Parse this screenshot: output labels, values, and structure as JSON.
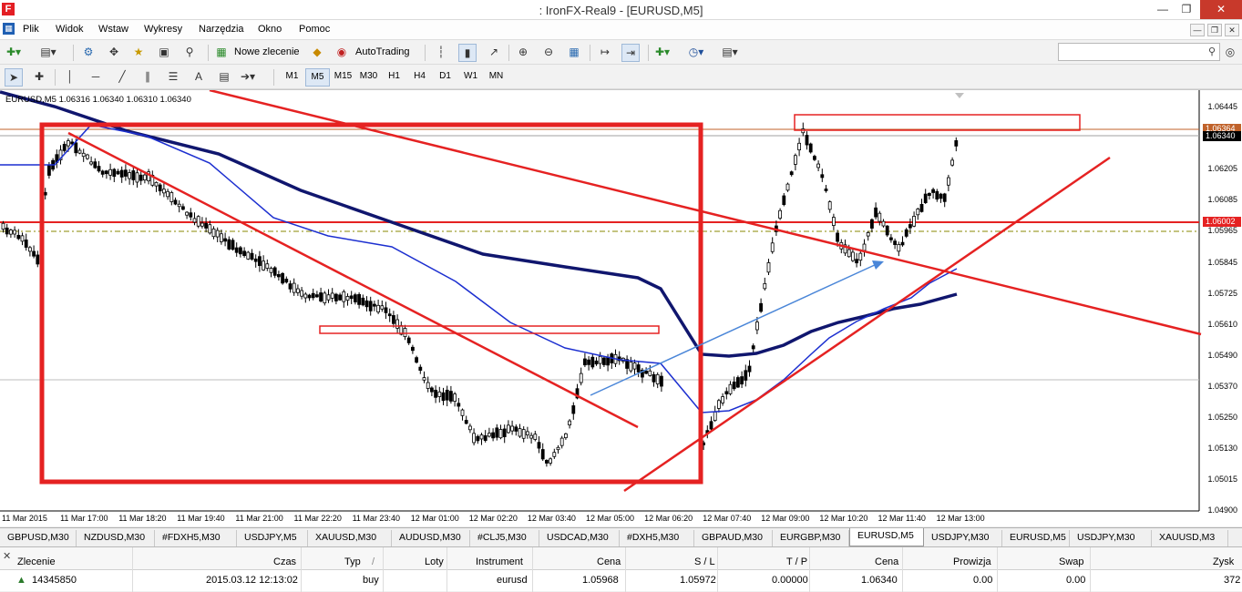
{
  "app": {
    "title": ": IronFX-Real9 - [EURUSD,M5]",
    "logo": "F"
  },
  "menu": [
    "Plik",
    "Widok",
    "Wstaw",
    "Wykresy",
    "Narzędzia",
    "Okno",
    "Pomoc"
  ],
  "toolbar": {
    "new_order_label": "Nowe zlecenie",
    "autotrading_label": "AutoTrading",
    "search_placeholder": ""
  },
  "timeframes": [
    "M1",
    "M5",
    "M15",
    "M30",
    "H1",
    "H4",
    "D1",
    "W1",
    "MN"
  ],
  "active_timeframe": "M5",
  "chart": {
    "header": "EURUSD,M5  1.06316 1.06340 1.06310 1.06340",
    "price_axis": [
      "1.06445",
      "1.06325",
      "1.06205",
      "1.06085",
      "1.05965",
      "1.05845",
      "1.05725",
      "1.05610",
      "1.05490",
      "1.05370",
      "1.05250",
      "1.05130",
      "1.05015",
      "1.04900"
    ],
    "tag_upper": "1.06364",
    "tag_current": "1.06340",
    "tag_level": "1.06002",
    "time_axis": [
      "11 Mar 2015",
      "11 Mar 17:00",
      "11 Mar 18:20",
      "11 Mar 19:40",
      "11 Mar 21:00",
      "11 Mar 22:20",
      "11 Mar 23:40",
      "12 Mar 01:00",
      "12 Mar 02:20",
      "12 Mar 03:40",
      "12 Mar 05:00",
      "12 Mar 06:20",
      "12 Mar 07:40",
      "12 Mar 09:00",
      "12 Mar 10:20",
      "12 Mar 11:40",
      "12 Mar 13:00"
    ],
    "colors": {
      "trendline": "#e52222",
      "ma_fast": "#1c2fd0",
      "ma_slow": "#10166e",
      "arrow": "#4a86d8",
      "candle": "#000000",
      "ask_line": "#c0622a",
      "dash_line": "#8a8a00"
    }
  },
  "tabs": [
    "GBPUSD,M30",
    "NZDUSD,M30",
    "#FDXH5,M30",
    "USDJPY,M5",
    "XAUUSD,M30",
    "AUDUSD,M30",
    "#CLJ5,M30",
    "USDCAD,M30",
    "#DXH5,M30",
    "GBPAUD,M30",
    "EURGBP,M30",
    "EURUSD,M5",
    "USDJPY,M30",
    "EURUSD,M5",
    "USDJPY,M30",
    "XAUUSD,M3"
  ],
  "active_tab": "EURUSD,M5",
  "orders": {
    "headers": {
      "order": "Zlecenie",
      "time": "Czas",
      "type": "Typ",
      "sort": "/",
      "lots": "Loty",
      "instrument": "Instrument",
      "price": "Cena",
      "sl": "S / L",
      "tp": "T / P",
      "price2": "Cena",
      "commission": "Prowizja",
      "swap": "Swap",
      "profit": "Zysk"
    },
    "rows": [
      {
        "order": "14345850",
        "time": "2015.03.12 12:13:02",
        "type": "buy",
        "lots": "",
        "instrument": "eurusd",
        "price": "1.05968",
        "sl": "1.05972",
        "tp": "0.00000",
        "price2": "1.06340",
        "commission": "0.00",
        "swap": "0.00",
        "profit": "372"
      }
    ]
  }
}
